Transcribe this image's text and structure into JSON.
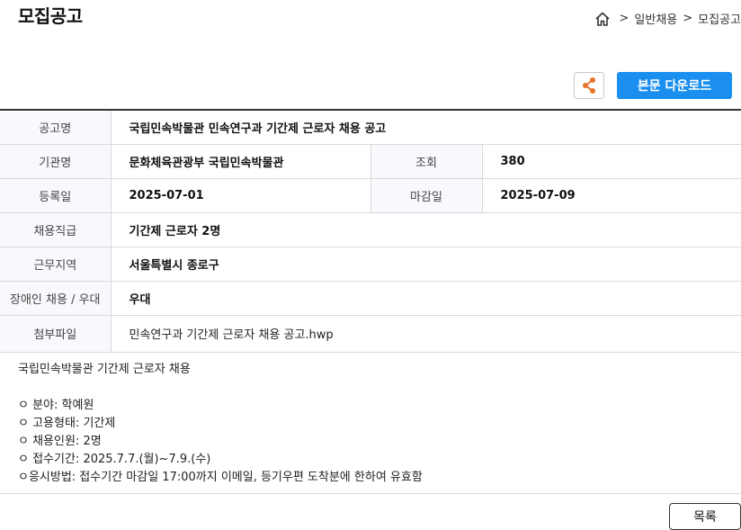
{
  "header": {
    "title": "모집공고",
    "breadcrumb": {
      "sep1": ">",
      "item1": "일반채용",
      "sep2": ">",
      "item2": "모집공고"
    }
  },
  "toolbar": {
    "download_label": "본문 다운로드"
  },
  "info": {
    "title_label": "공고명",
    "title_value": "국립민속박물관 민속연구과 기간제 근로자 채용 공고",
    "org_label": "기관명",
    "org_value": "문화체육관광부 국립민속박물관",
    "views_label": "조회",
    "views_value": "380",
    "reg_label": "등록일",
    "reg_value": "2025-07-01",
    "deadline_label": "마감일",
    "deadline_value": "2025-07-09",
    "position_label": "채용직급",
    "position_value": "기간제 근로자 2명",
    "region_label": "근무지역",
    "region_value": "서울특별시 종로구",
    "disabled_label": "장애인 채용 / 우대",
    "disabled_value": "우대",
    "attach_label": "첨부파일",
    "attach_value": "민속연구과 기간제 근로자 채용 공고.hwp"
  },
  "body": {
    "lines": [
      "국립민속박물관 기간제 근로자 채용",
      "",
      "ㅇ 분야: 학예원",
      "ㅇ 고용형태: 기간제",
      "ㅇ 채용인원: 2명",
      "ㅇ 접수기간: 2025.7.7.(월)~7.9.(수)",
      "ㅇ응시방법: 접수기간 마감일 17:00까지 이메일, 등기우편 도착분에 한하여 유효함"
    ]
  },
  "footer": {
    "list_label": "목록"
  },
  "colors": {
    "accent": "#1a8ff0",
    "share_icon": "#e8732c",
    "label_bg": "#f7f9fc"
  }
}
